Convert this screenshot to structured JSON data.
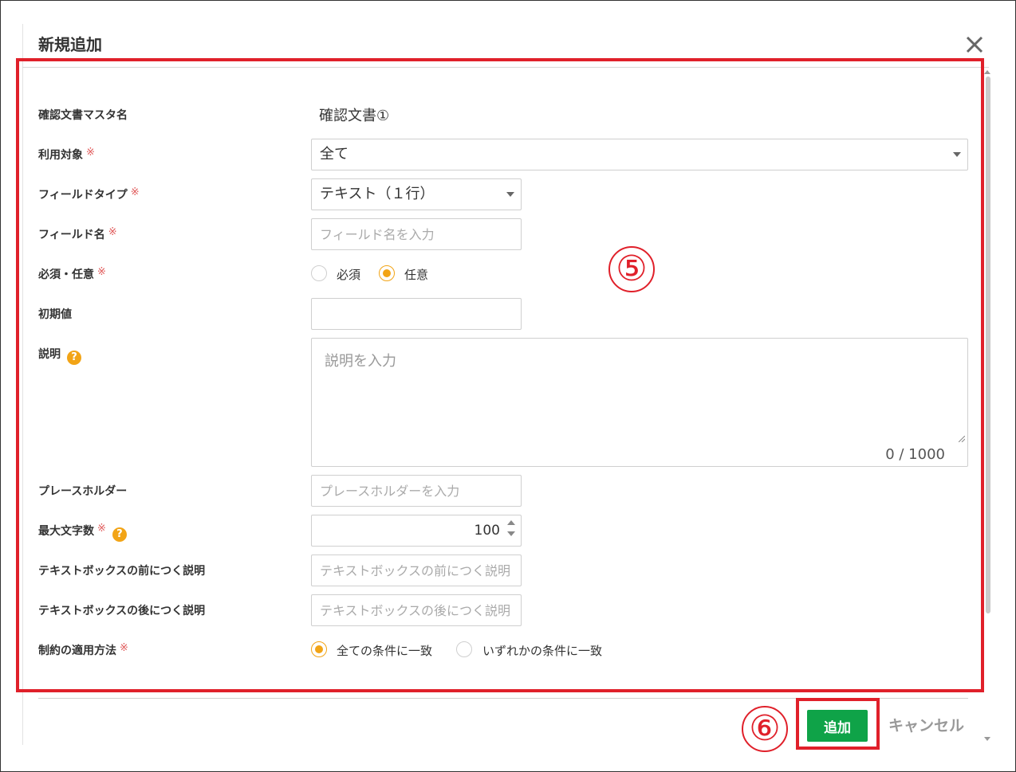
{
  "dialog": {
    "title": "新規追加"
  },
  "form": {
    "master_name": {
      "label": "確認文書マスタ名",
      "value": "確認文書①"
    },
    "target": {
      "label": "利用対象",
      "required_mark": "※",
      "selected": "全て"
    },
    "field_type": {
      "label": "フィールドタイプ",
      "required_mark": "※",
      "selected": "テキスト（１行）"
    },
    "field_name": {
      "label": "フィールド名",
      "required_mark": "※",
      "placeholder": "フィールド名を入力",
      "value": ""
    },
    "required_optional": {
      "label": "必須・任意",
      "required_mark": "※",
      "options": [
        "必須",
        "任意"
      ],
      "selected": "任意"
    },
    "initial_value": {
      "label": "初期値",
      "value": ""
    },
    "description": {
      "label": "説明",
      "placeholder": "説明を入力",
      "counter": "0 / 1000"
    },
    "placeholder_field": {
      "label": "プレースホルダー",
      "placeholder": "プレースホルダーを入力",
      "value": ""
    },
    "max_chars": {
      "label": "最大文字数",
      "required_mark": "※",
      "value": "100"
    },
    "prefix_text": {
      "label": "テキストボックスの前につく説明",
      "placeholder": "テキストボックスの前につく説明",
      "value": ""
    },
    "suffix_text": {
      "label": "テキストボックスの後につく説明",
      "placeholder": "テキストボックスの後につく説明",
      "value": ""
    },
    "constraint_method": {
      "label": "制約の適用方法",
      "required_mark": "※",
      "options": [
        "全ての条件に一致",
        "いずれかの条件に一致"
      ],
      "selected": "全ての条件に一致"
    }
  },
  "footer": {
    "add_label": "追加",
    "cancel_label": "キャンセル"
  },
  "annotations": {
    "marker5": "⑤",
    "marker6": "⑥",
    "highlight_color": "#e0202a"
  },
  "colors": {
    "accent_orange": "#f2a416",
    "primary_green": "#0fa348",
    "required_red": "#e05a5a"
  },
  "icons": {
    "close": "close-icon",
    "help": "question-icon",
    "dropdown": "caret-down-icon"
  }
}
